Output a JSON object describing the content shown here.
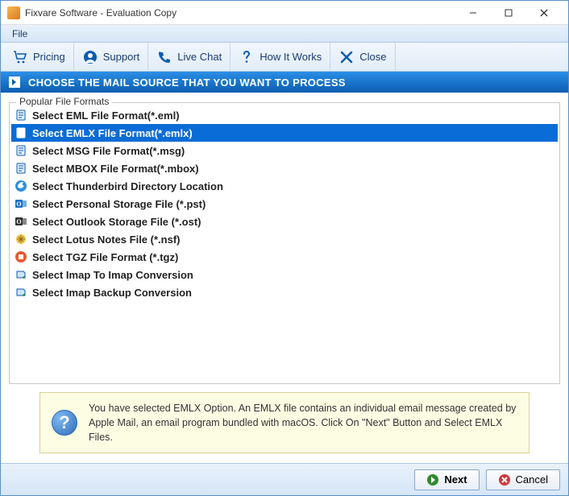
{
  "window": {
    "title": "Fixvare Software - Evaluation Copy"
  },
  "menubar": {
    "file": "File"
  },
  "toolbar": {
    "pricing": "Pricing",
    "support": "Support",
    "livechat": "Live Chat",
    "howitworks": "How It Works",
    "close": "Close"
  },
  "banner": {
    "text": "CHOOSE THE MAIL SOURCE THAT YOU WANT TO PROCESS"
  },
  "fieldset": {
    "legend": "Popular File Formats"
  },
  "formats": [
    {
      "label": "Select EML File Format(*.eml)",
      "icon": "file-blue",
      "selected": false
    },
    {
      "label": "Select EMLX File Format(*.emlx)",
      "icon": "file-white",
      "selected": true
    },
    {
      "label": "Select MSG File Format(*.msg)",
      "icon": "file-blue",
      "selected": false
    },
    {
      "label": "Select MBOX File Format(*.mbox)",
      "icon": "file-blue",
      "selected": false
    },
    {
      "label": "Select Thunderbird Directory Location",
      "icon": "tbird",
      "selected": false
    },
    {
      "label": "Select Personal Storage File (*.pst)",
      "icon": "outlook",
      "selected": false
    },
    {
      "label": "Select Outlook Storage File (*.ost)",
      "icon": "outlook-dark",
      "selected": false
    },
    {
      "label": "Select Lotus Notes File (*.nsf)",
      "icon": "lotus",
      "selected": false
    },
    {
      "label": "Select TGZ File Format (*.tgz)",
      "icon": "tgz",
      "selected": false
    },
    {
      "label": "Select Imap To Imap Conversion",
      "icon": "imap",
      "selected": false
    },
    {
      "label": "Select Imap Backup Conversion",
      "icon": "imap",
      "selected": false
    }
  ],
  "info": {
    "text": "You have selected EMLX Option. An EMLX file contains an individual email message created by Apple Mail, an email program bundled with macOS. Click On \"Next\" Button and Select EMLX Files."
  },
  "footer": {
    "next": "Next",
    "cancel": "Cancel"
  }
}
